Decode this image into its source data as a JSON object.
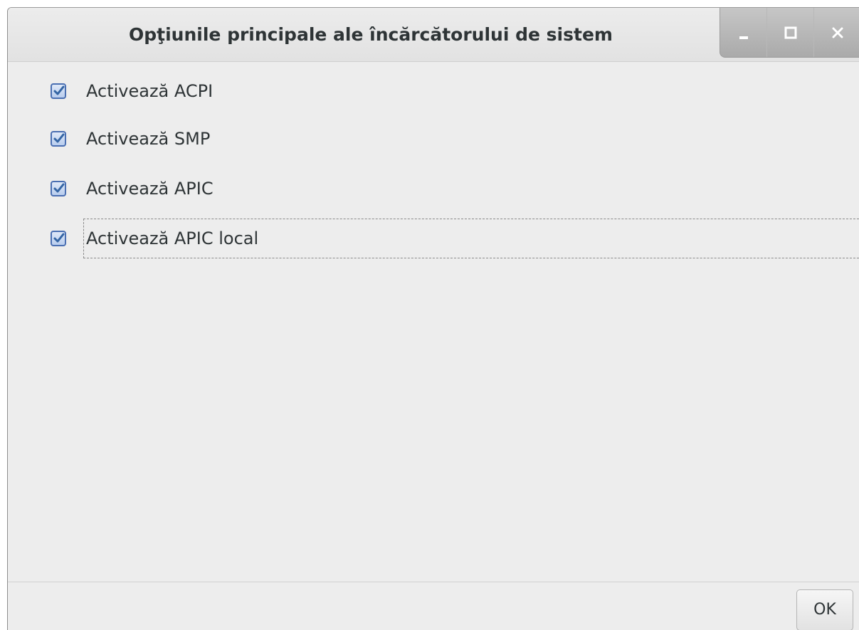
{
  "window": {
    "title": "Opţiunile principale ale încărcătorului de sistem",
    "controls": {
      "minimize_icon": "minimize-icon",
      "maximize_icon": "maximize-icon",
      "close_icon": "close-icon"
    }
  },
  "options": [
    {
      "label": "Activează ACPI",
      "checked": true
    },
    {
      "label": "Activează SMP",
      "checked": true
    },
    {
      "label": "Activează APIC",
      "checked": true
    },
    {
      "label": "Activează APIC local",
      "checked": true,
      "focused": true
    }
  ],
  "footer": {
    "ok_label": "OK"
  },
  "colors": {
    "accent": "#4a6fb2",
    "checkmark": "#3465a4",
    "text": "#2e3436",
    "background": "#ededed"
  }
}
